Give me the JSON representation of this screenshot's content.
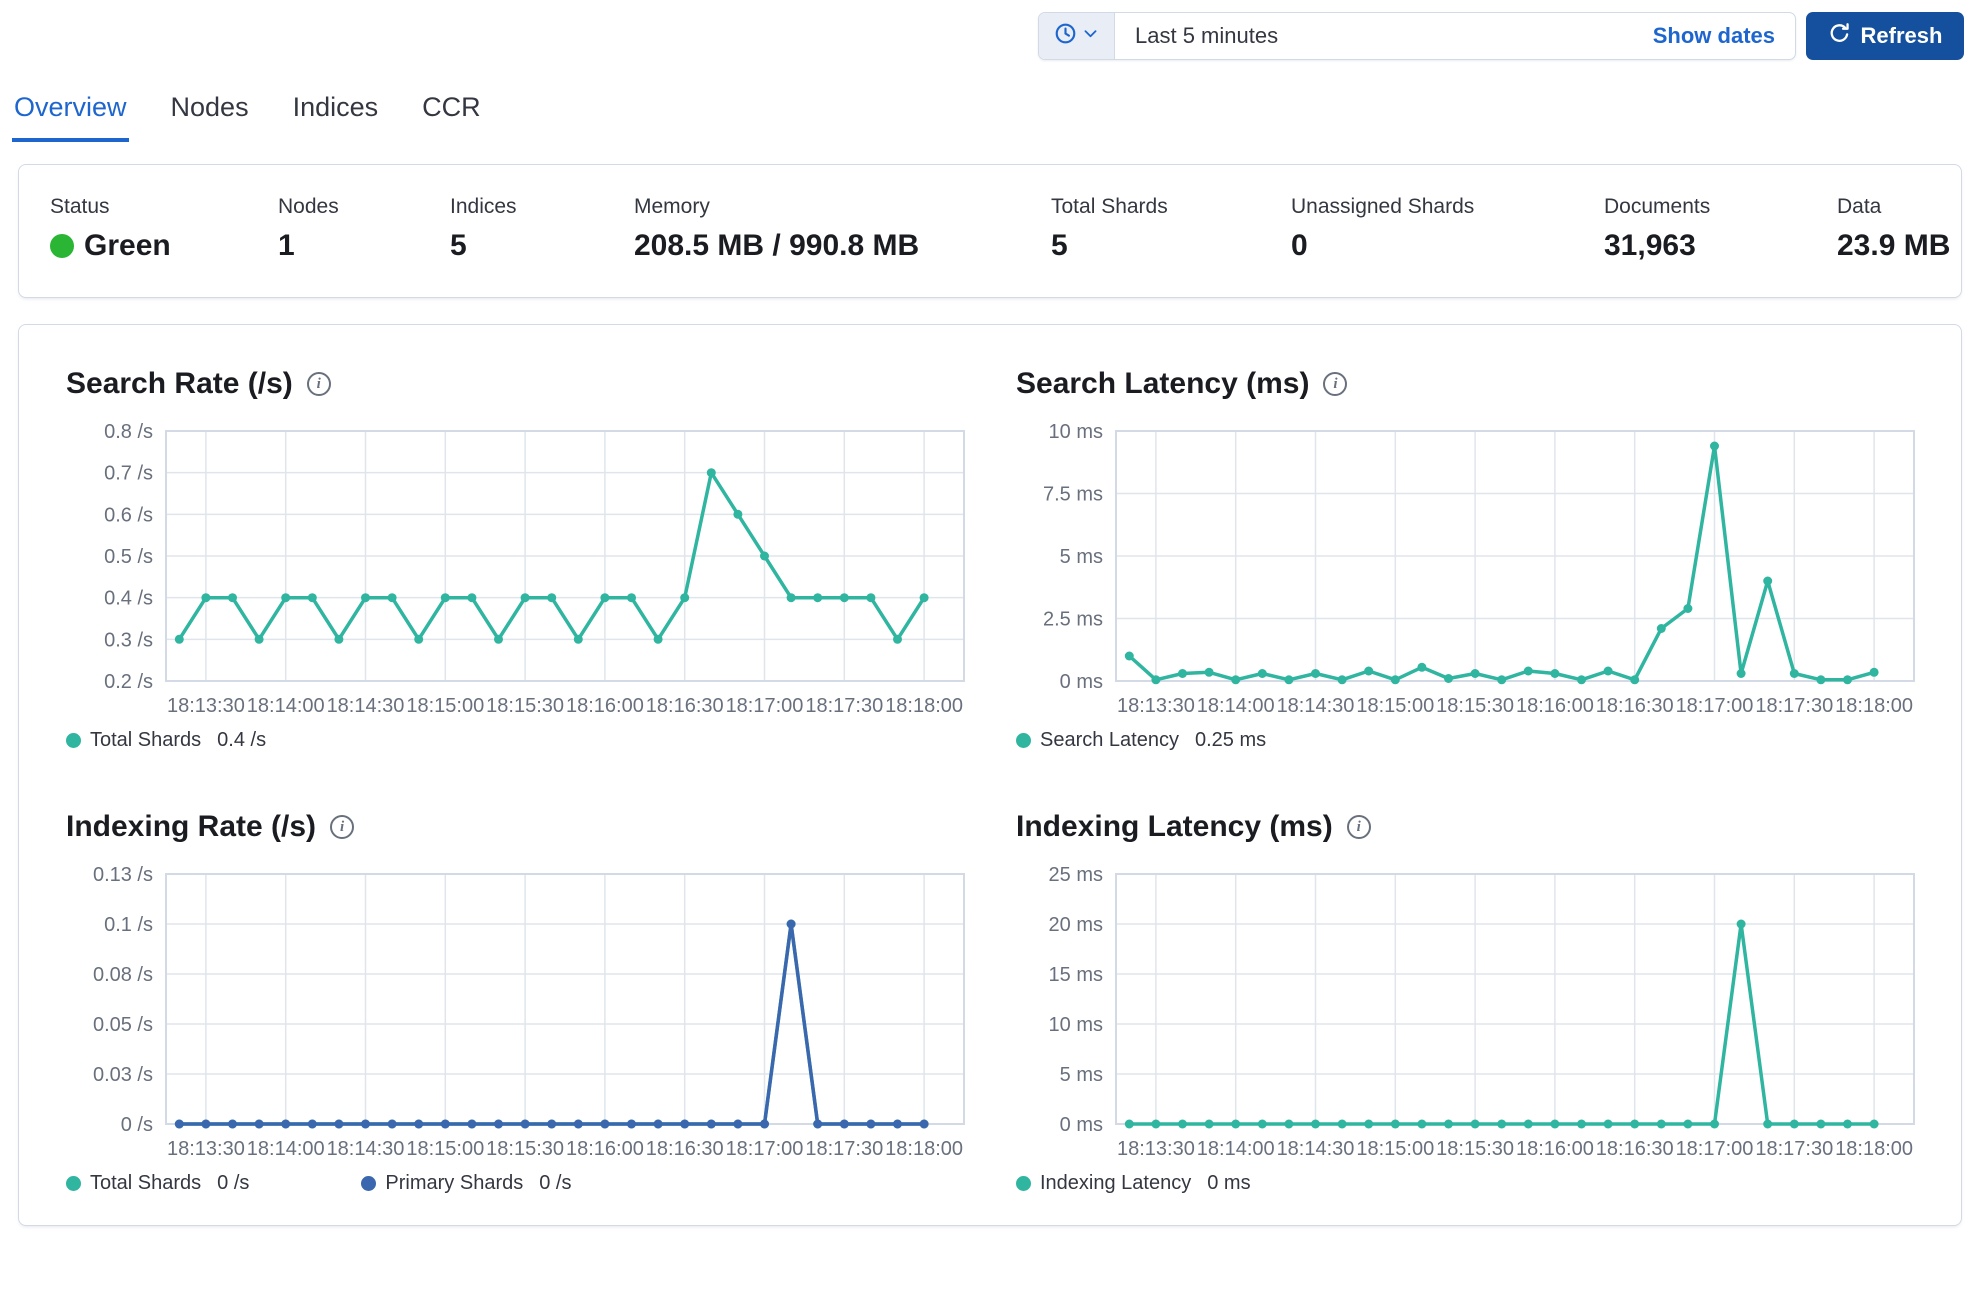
{
  "colors": {
    "teal": "#2FB5A0",
    "blue": "#3A67AE",
    "link": "#1E66CE",
    "button": "#15509E",
    "status_green": "#2BB534"
  },
  "time_bar": {
    "selected_range": "Last 5 minutes",
    "show_dates_label": "Show dates",
    "refresh_label": "Refresh"
  },
  "tabs": [
    {
      "label": "Overview",
      "active": true
    },
    {
      "label": "Nodes",
      "active": false
    },
    {
      "label": "Indices",
      "active": false
    },
    {
      "label": "CCR",
      "active": false
    }
  ],
  "summary": {
    "items": [
      {
        "label": "Status",
        "value": "Green",
        "type": "status"
      },
      {
        "label": "Nodes",
        "value": "1"
      },
      {
        "label": "Indices",
        "value": "5"
      },
      {
        "label": "Memory",
        "value": "208.5 MB / 990.8 MB"
      },
      {
        "label": "Total Shards",
        "value": "5"
      },
      {
        "label": "Unassigned Shards",
        "value": "0"
      },
      {
        "label": "Documents",
        "value": "31,963"
      },
      {
        "label": "Data",
        "value": "23.9 MB"
      }
    ]
  },
  "chart_data": [
    {
      "type": "line",
      "title": "Search Rate (/s)",
      "ylim": [
        0.2,
        0.8
      ],
      "y_ticks": [
        {
          "v": 0.8,
          "label": "0.8 /s"
        },
        {
          "v": 0.7,
          "label": "0.7 /s"
        },
        {
          "v": 0.6,
          "label": "0.6 /s"
        },
        {
          "v": 0.5,
          "label": "0.5 /s"
        },
        {
          "v": 0.4,
          "label": "0.4 /s"
        },
        {
          "v": 0.3,
          "label": "0.3 /s"
        },
        {
          "v": 0.2,
          "label": "0.2 /s"
        }
      ],
      "x_labels": [
        "18:13:30",
        "18:14:00",
        "18:14:30",
        "18:15:00",
        "18:15:30",
        "18:16:00",
        "18:16:30",
        "18:17:00",
        "18:17:30",
        "18:18:00"
      ],
      "x_domain": 300,
      "x_grid_first": 15,
      "x_grid_step": 30,
      "point_first": 5,
      "point_step": 10,
      "series": [
        {
          "name": "Total Shards",
          "color": "teal",
          "values": [
            0.3,
            0.4,
            0.4,
            0.3,
            0.4,
            0.4,
            0.3,
            0.4,
            0.4,
            0.3,
            0.4,
            0.4,
            0.3,
            0.4,
            0.4,
            0.3,
            0.4,
            0.4,
            0.3,
            0.4,
            0.7,
            0.6,
            0.5,
            0.4,
            0.4,
            0.4,
            0.4,
            0.3,
            0.4
          ]
        }
      ],
      "legend": [
        {
          "name": "Total Shards",
          "value": "0.4 /s",
          "color": "teal"
        }
      ]
    },
    {
      "type": "line",
      "title": "Search Latency (ms)",
      "ylim": [
        0,
        10
      ],
      "y_ticks": [
        {
          "v": 10,
          "label": "10 ms"
        },
        {
          "v": 7.5,
          "label": "7.5 ms"
        },
        {
          "v": 5,
          "label": "5 ms"
        },
        {
          "v": 2.5,
          "label": "2.5 ms"
        },
        {
          "v": 0,
          "label": "0 ms"
        }
      ],
      "x_labels": [
        "18:13:30",
        "18:14:00",
        "18:14:30",
        "18:15:00",
        "18:15:30",
        "18:16:00",
        "18:16:30",
        "18:17:00",
        "18:17:30",
        "18:18:00"
      ],
      "x_domain": 300,
      "x_grid_first": 15,
      "x_grid_step": 30,
      "point_first": 5,
      "point_step": 10,
      "series": [
        {
          "name": "Search Latency",
          "color": "teal",
          "values": [
            1.0,
            0.05,
            0.3,
            0.35,
            0.05,
            0.3,
            0.05,
            0.3,
            0.05,
            0.4,
            0.05,
            0.55,
            0.1,
            0.3,
            0.05,
            0.4,
            0.3,
            0.05,
            0.4,
            0.05,
            2.1,
            2.9,
            9.4,
            0.3,
            4.0,
            0.3,
            0.05,
            0.05,
            0.35
          ]
        }
      ],
      "legend": [
        {
          "name": "Search Latency",
          "value": "0.25 ms",
          "color": "teal"
        }
      ]
    },
    {
      "type": "line",
      "title": "Indexing Rate (/s)",
      "ylim": [
        0,
        0.125
      ],
      "y_ticks": [
        {
          "v": 0.125,
          "label": "0.13 /s"
        },
        {
          "v": 0.1,
          "label": "0.1 /s"
        },
        {
          "v": 0.075,
          "label": "0.08 /s"
        },
        {
          "v": 0.05,
          "label": "0.05 /s"
        },
        {
          "v": 0.025,
          "label": "0.03 /s"
        },
        {
          "v": 0,
          "label": "0 /s"
        }
      ],
      "x_labels": [
        "18:13:30",
        "18:14:00",
        "18:14:30",
        "18:15:00",
        "18:15:30",
        "18:16:00",
        "18:16:30",
        "18:17:00",
        "18:17:30",
        "18:18:00"
      ],
      "x_domain": 300,
      "x_grid_first": 15,
      "x_grid_step": 30,
      "point_first": 5,
      "point_step": 10,
      "series": [
        {
          "name": "Total Shards",
          "color": "teal",
          "values": [
            0,
            0,
            0,
            0,
            0,
            0,
            0,
            0,
            0,
            0,
            0,
            0,
            0,
            0,
            0,
            0,
            0,
            0,
            0,
            0,
            0,
            0,
            0,
            0.1,
            0,
            0,
            0,
            0,
            0
          ]
        },
        {
          "name": "Primary Shards",
          "color": "blue",
          "values": [
            0,
            0,
            0,
            0,
            0,
            0,
            0,
            0,
            0,
            0,
            0,
            0,
            0,
            0,
            0,
            0,
            0,
            0,
            0,
            0,
            0,
            0,
            0,
            0.1,
            0,
            0,
            0,
            0,
            0
          ]
        }
      ],
      "legend": [
        {
          "name": "Total Shards",
          "value": "0 /s",
          "color": "teal"
        },
        {
          "name": "Primary Shards",
          "value": "0 /s",
          "color": "blue"
        }
      ]
    },
    {
      "type": "line",
      "title": "Indexing Latency (ms)",
      "ylim": [
        0,
        25
      ],
      "y_ticks": [
        {
          "v": 25,
          "label": "25 ms"
        },
        {
          "v": 20,
          "label": "20 ms"
        },
        {
          "v": 15,
          "label": "15 ms"
        },
        {
          "v": 10,
          "label": "10 ms"
        },
        {
          "v": 5,
          "label": "5 ms"
        },
        {
          "v": 0,
          "label": "0 ms"
        }
      ],
      "x_labels": [
        "18:13:30",
        "18:14:00",
        "18:14:30",
        "18:15:00",
        "18:15:30",
        "18:16:00",
        "18:16:30",
        "18:17:00",
        "18:17:30",
        "18:18:00"
      ],
      "x_domain": 300,
      "x_grid_first": 15,
      "x_grid_step": 30,
      "point_first": 5,
      "point_step": 10,
      "series": [
        {
          "name": "Indexing Latency",
          "color": "teal",
          "values": [
            0,
            0,
            0,
            0,
            0,
            0,
            0,
            0,
            0,
            0,
            0,
            0,
            0,
            0,
            0,
            0,
            0,
            0,
            0,
            0,
            0,
            0,
            0,
            20,
            0,
            0,
            0,
            0,
            0
          ]
        }
      ],
      "legend": [
        {
          "name": "Indexing Latency",
          "value": "0 ms",
          "color": "teal"
        }
      ]
    }
  ]
}
